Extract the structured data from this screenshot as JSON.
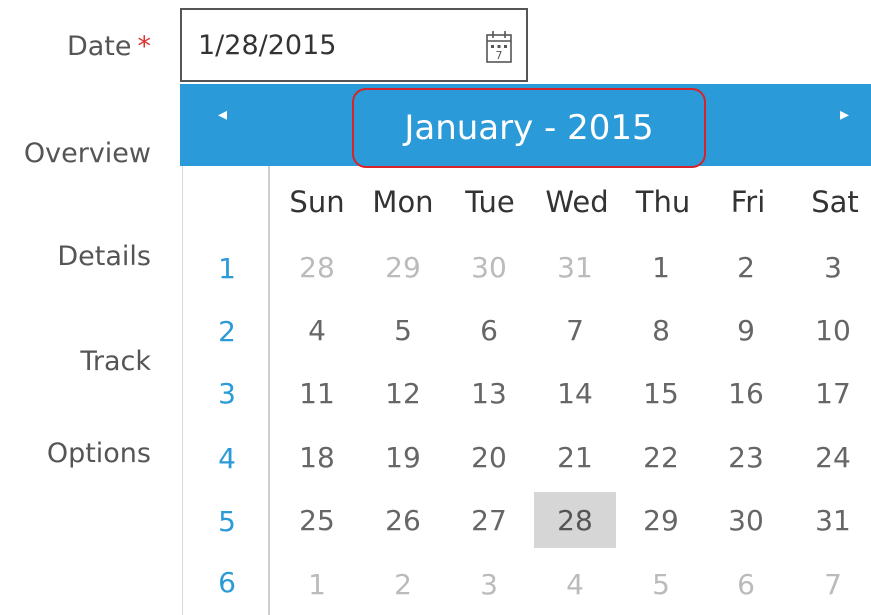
{
  "form": {
    "date_label": "Date",
    "required_marker": "*",
    "date_value": "1/28/2015",
    "sections": [
      "Overview",
      "Details",
      "Track",
      "Options"
    ]
  },
  "calendar": {
    "month_title": "January - 2015",
    "prev_glyph": "◂",
    "next_glyph": "▸",
    "days_of_week": [
      "Sun",
      "Mon",
      "Tue",
      "Wed",
      "Thu",
      "Fri",
      "Sat"
    ],
    "week_numbers": [
      "1",
      "2",
      "3",
      "4",
      "5",
      "6"
    ],
    "weeks": [
      [
        "28",
        "29",
        "30",
        "31",
        "1",
        "2",
        "3"
      ],
      [
        "4",
        "5",
        "6",
        "7",
        "8",
        "9",
        "10"
      ],
      [
        "11",
        "12",
        "13",
        "14",
        "15",
        "16",
        "17"
      ],
      [
        "18",
        "19",
        "20",
        "21",
        "22",
        "23",
        "24"
      ],
      [
        "25",
        "26",
        "27",
        "28",
        "29",
        "30",
        "31"
      ],
      [
        "1",
        "2",
        "3",
        "4",
        "5",
        "6",
        "7"
      ]
    ],
    "other_month": [
      [
        true,
        true,
        true,
        true,
        false,
        false,
        false
      ],
      [
        false,
        false,
        false,
        false,
        false,
        false,
        false
      ],
      [
        false,
        false,
        false,
        false,
        false,
        false,
        false
      ],
      [
        false,
        false,
        false,
        false,
        false,
        false,
        false
      ],
      [
        false,
        false,
        false,
        false,
        false,
        false,
        false
      ],
      [
        true,
        true,
        true,
        true,
        true,
        true,
        true
      ]
    ],
    "selected_day": "28",
    "accent_color": "#2b9ad8",
    "highlight_color": "#d8232a",
    "icon": "calendar-icon"
  }
}
